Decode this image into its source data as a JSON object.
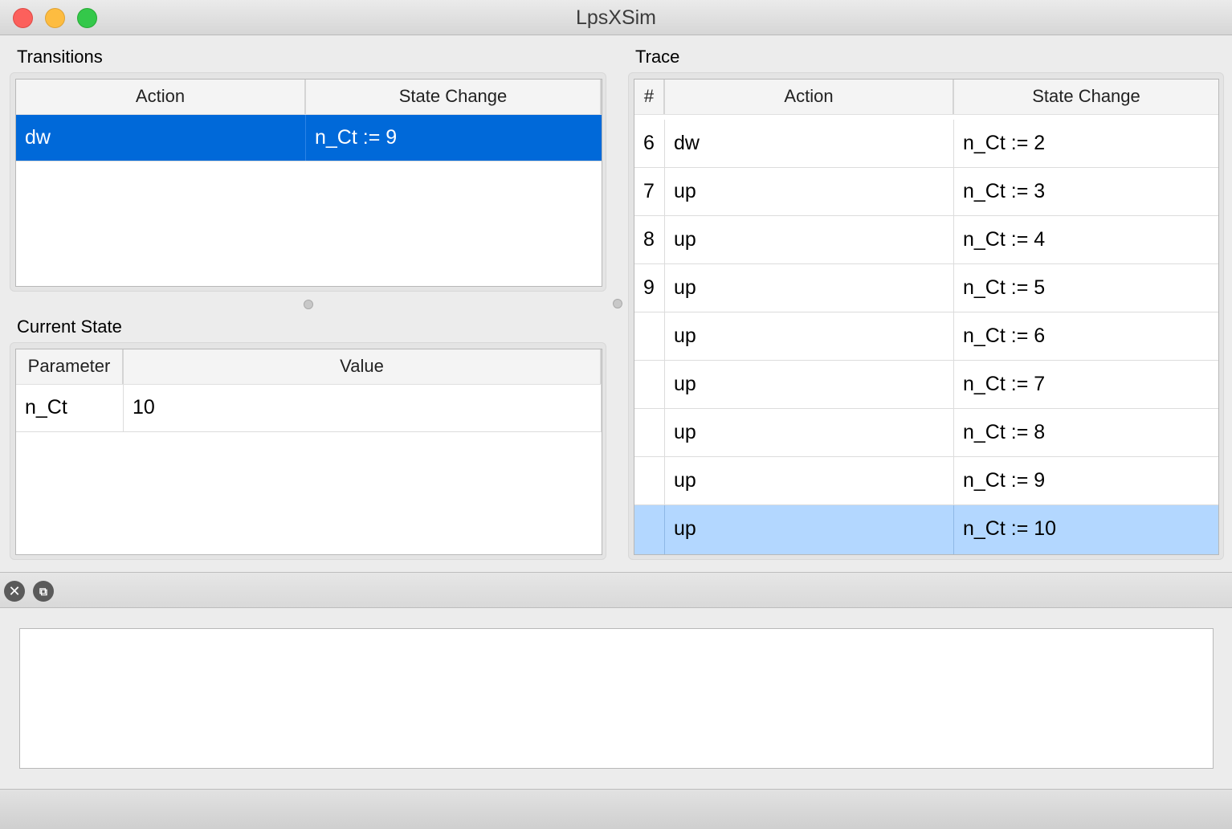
{
  "window": {
    "title": "LpsXSim"
  },
  "transitions": {
    "label": "Transitions",
    "headers": {
      "action": "Action",
      "state_change": "State Change"
    },
    "rows": [
      {
        "action": "dw",
        "state_change": "n_Ct := 9"
      }
    ]
  },
  "current_state": {
    "label": "Current State",
    "headers": {
      "parameter": "Parameter",
      "value": "Value"
    },
    "rows": [
      {
        "parameter": "n_Ct",
        "value": "10"
      }
    ]
  },
  "trace": {
    "label": "Trace",
    "headers": {
      "index": "#",
      "action": "Action",
      "state_change": "State Change"
    },
    "rows": [
      {
        "index": "6",
        "action": "dw",
        "state_change": "n_Ct := 2"
      },
      {
        "index": "7",
        "action": "up",
        "state_change": "n_Ct := 3"
      },
      {
        "index": "8",
        "action": "up",
        "state_change": "n_Ct := 4"
      },
      {
        "index": "9",
        "action": "up",
        "state_change": "n_Ct := 5"
      },
      {
        "index": "",
        "action": "up",
        "state_change": "n_Ct := 6"
      },
      {
        "index": "",
        "action": "up",
        "state_change": "n_Ct := 7"
      },
      {
        "index": "",
        "action": "up",
        "state_change": "n_Ct := 8"
      },
      {
        "index": "",
        "action": "up",
        "state_change": "n_Ct := 9"
      },
      {
        "index": "",
        "action": "up",
        "state_change": "n_Ct := 10"
      }
    ]
  },
  "dock": {
    "close_icon": "close-circle-icon",
    "float_icon": "undock-icon"
  },
  "colors": {
    "selection_active": "#0069d9",
    "selection_inactive": "#b3d7ff"
  }
}
